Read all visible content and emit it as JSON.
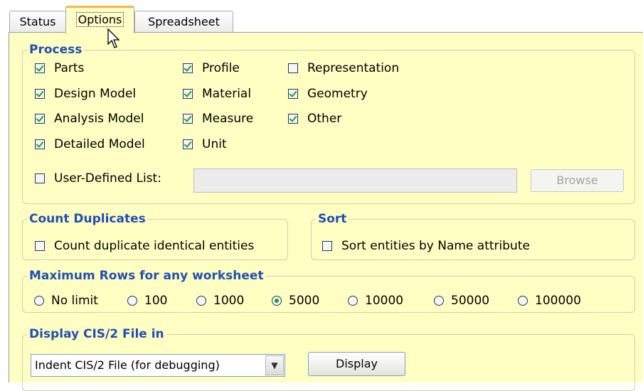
{
  "tabs": [
    {
      "label": "Status"
    },
    {
      "label": "Options"
    },
    {
      "label": "Spreadsheet"
    }
  ],
  "process": {
    "title": "Process",
    "columns": [
      [
        {
          "label": "Parts",
          "checked": true
        },
        {
          "label": "Design Model",
          "checked": true
        },
        {
          "label": "Analysis Model",
          "checked": true
        },
        {
          "label": "Detailed Model",
          "checked": true
        }
      ],
      [
        {
          "label": "Profile",
          "checked": true
        },
        {
          "label": "Material",
          "checked": true
        },
        {
          "label": "Measure",
          "checked": true
        },
        {
          "label": "Unit",
          "checked": true
        }
      ],
      [
        {
          "label": "Representation",
          "checked": false
        },
        {
          "label": "Geometry",
          "checked": true
        },
        {
          "label": "Other",
          "checked": true
        }
      ]
    ],
    "user_defined": {
      "label": "User-Defined List:",
      "checked": false,
      "value": ""
    },
    "browse_label": "Browse"
  },
  "count_duplicates": {
    "title": "Count Duplicates",
    "option": {
      "label": "Count duplicate identical entities",
      "checked": false
    }
  },
  "sort": {
    "title": "Sort",
    "option": {
      "label": "Sort entities by Name attribute",
      "checked": false
    }
  },
  "max_rows": {
    "title": "Maximum Rows for any worksheet",
    "options": [
      "No limit",
      "100",
      "1000",
      "5000",
      "10000",
      "50000",
      "100000"
    ],
    "selected": "5000"
  },
  "display": {
    "title": "Display CIS/2 File in",
    "selected": "Indent CIS/2 File (for debugging)",
    "button_label": "Display"
  }
}
